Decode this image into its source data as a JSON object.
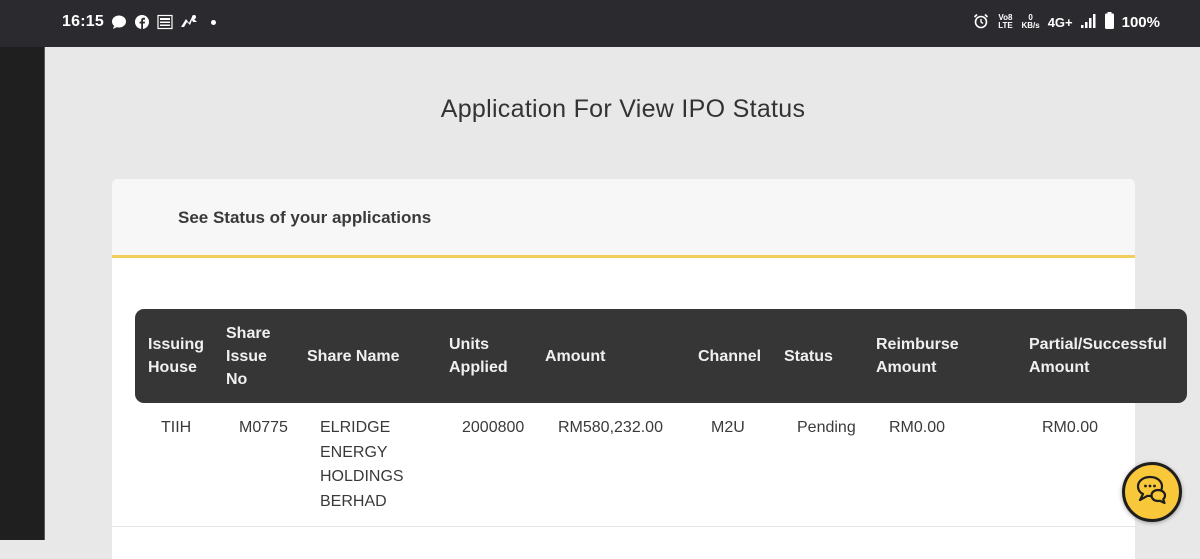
{
  "status_bar": {
    "time": "16:15",
    "left_icons": [
      "chat-bubble-icon",
      "facebook-icon",
      "news-app-icon",
      "swimmer-app-icon",
      "notification-dot-icon"
    ],
    "volte": "Vo8 LTE",
    "net_speed_value": "0",
    "net_speed_unit": "KB/s",
    "network": "4G+",
    "battery": "100%"
  },
  "page": {
    "title": "Application For View IPO Status"
  },
  "card": {
    "title": "See Status of your applications",
    "accent_color": "#f3cd5e"
  },
  "table": {
    "columns": [
      {
        "key": "issuing_house",
        "label": "Issuing House"
      },
      {
        "key": "share_issue_no",
        "label": "Share Issue No"
      },
      {
        "key": "share_name",
        "label": "Share Name"
      },
      {
        "key": "units_applied",
        "label": "Units Applied"
      },
      {
        "key": "amount",
        "label": "Amount"
      },
      {
        "key": "channel",
        "label": "Channel"
      },
      {
        "key": "status",
        "label": "Status"
      },
      {
        "key": "reimburse_amount",
        "label": "Reimburse Amount"
      },
      {
        "key": "partial_successful_amount",
        "label": "Partial/Successful Amount"
      }
    ],
    "rows": [
      {
        "issuing_house": "TIIH",
        "share_issue_no": "M0775",
        "share_name": "ELRIDGE ENERGY HOLDINGS BERHAD",
        "units_applied": "2000800",
        "amount": "RM580,232.00",
        "channel": "M2U",
        "status": "Pending",
        "reimburse_amount": "RM0.00",
        "partial_successful_amount": "RM0.00"
      }
    ]
  },
  "chat_button": {
    "icon": "chat-bubbles-icon",
    "color": "#f9c73a"
  }
}
